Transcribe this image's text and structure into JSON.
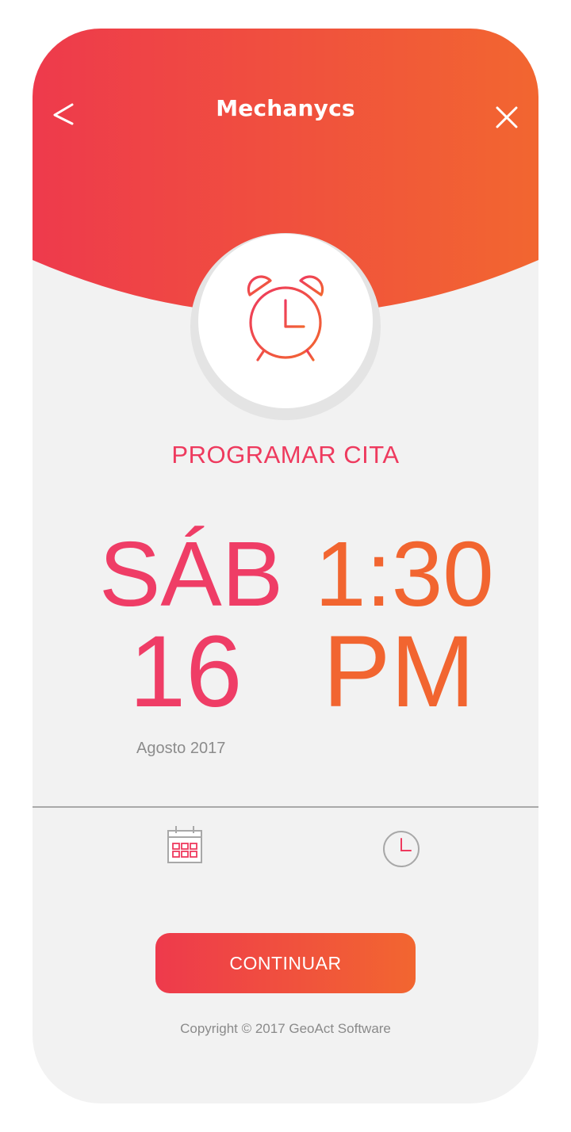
{
  "header": {
    "title": "Mechanycs",
    "back_icon": "chevron-left-icon",
    "close_icon": "close-icon",
    "icon": "alarm-clock-icon"
  },
  "main": {
    "section_title": "PROGRAMAR CITA",
    "date": {
      "day_name": "SÁB",
      "day_number": "16",
      "month_year": "Agosto 2017"
    },
    "time": {
      "value": "1:30",
      "period": "PM"
    }
  },
  "pickers": {
    "calendar_icon": "calendar-icon",
    "clock_icon": "clock-icon"
  },
  "actions": {
    "continue_label": "CONTINUAR"
  },
  "footer": {
    "copyright": "Copyright © 2017 GeoAct Software"
  },
  "colors": {
    "gradient_start": "#ee3a4c",
    "gradient_end": "#f26630",
    "date_color": "#ef3d66",
    "time_color": "#f26530",
    "background": "#f2f2f2"
  }
}
